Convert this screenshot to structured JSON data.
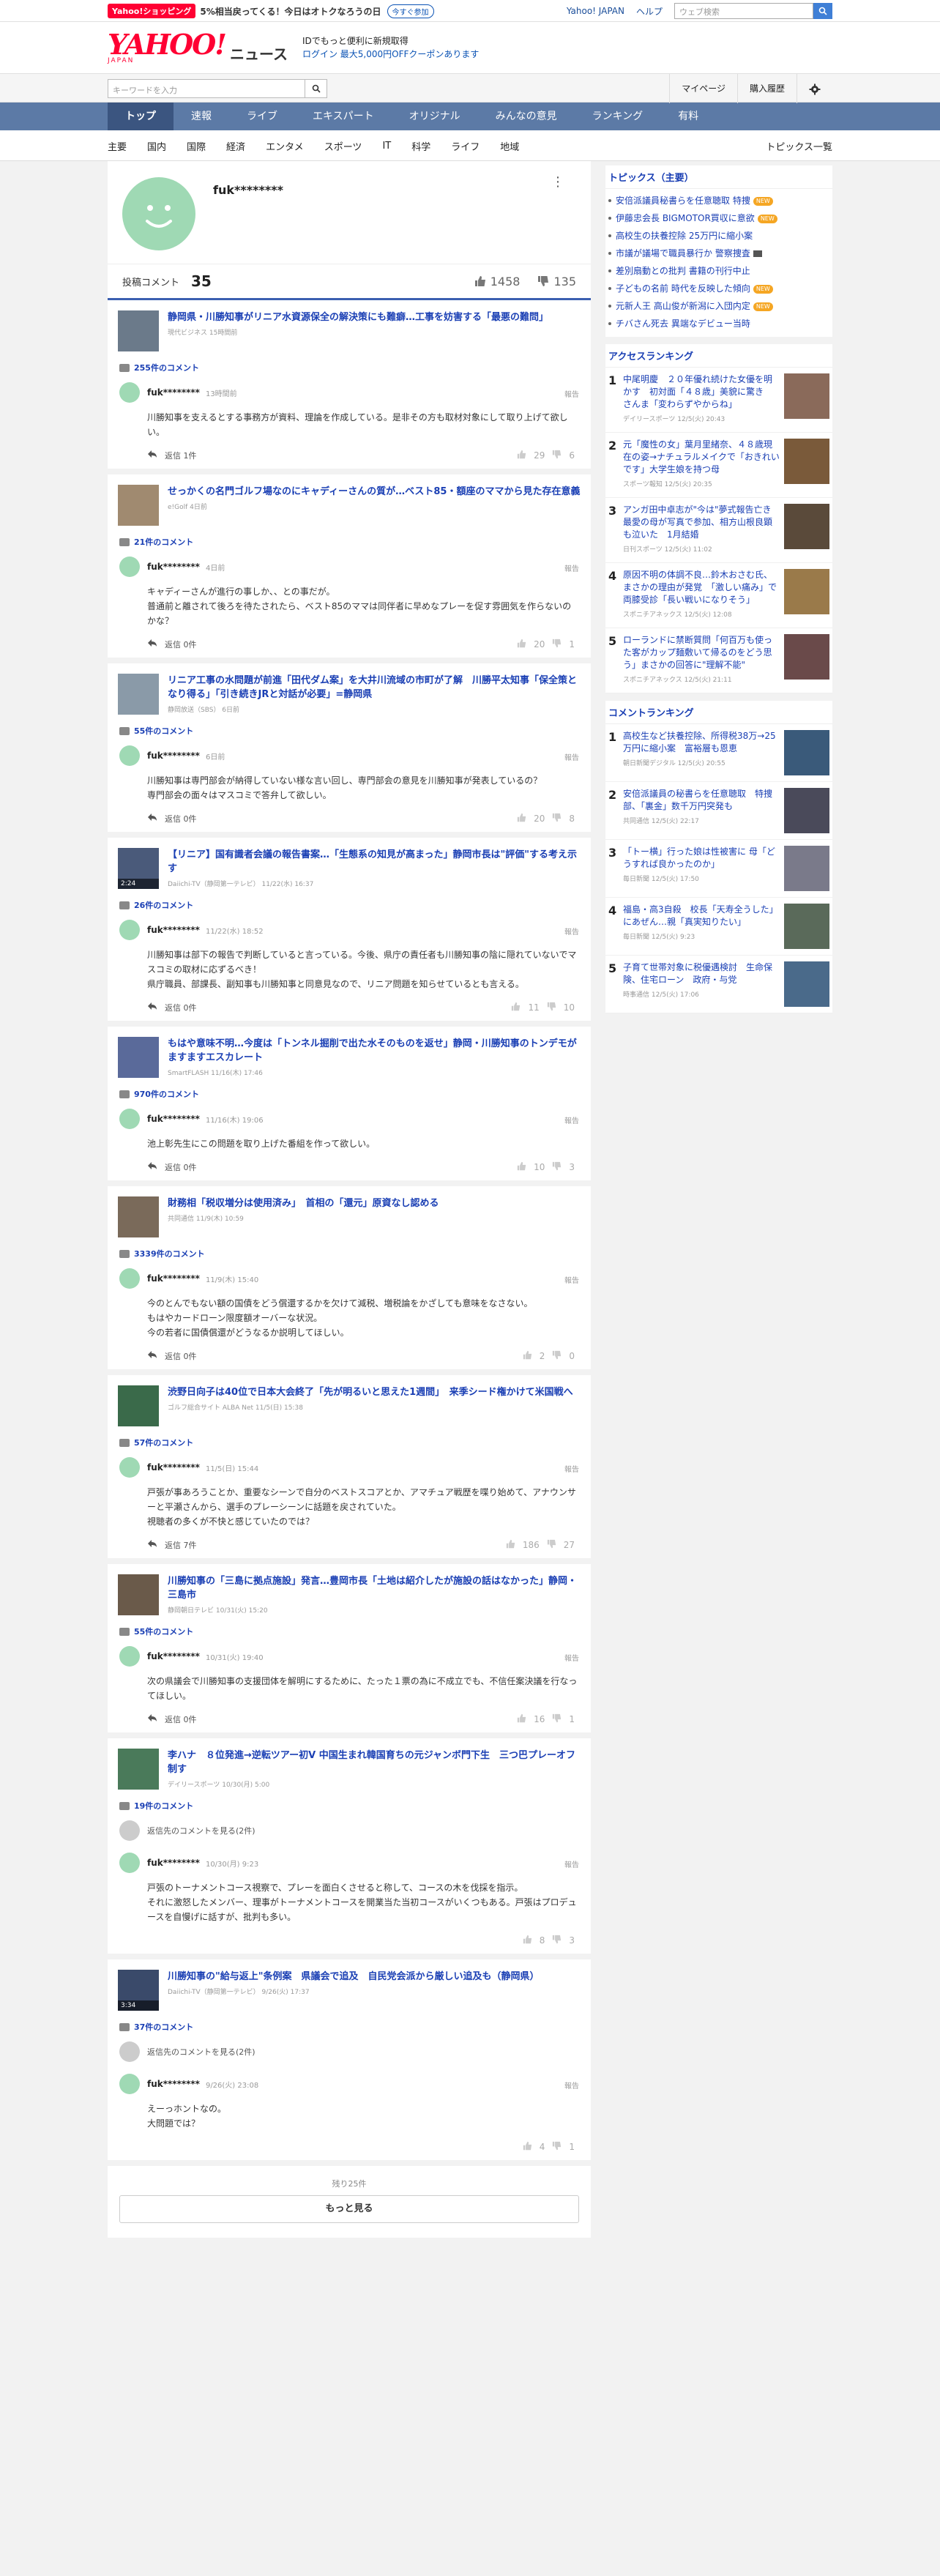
{
  "topstrip": {
    "shopping": "Yahoo!ショッピング",
    "msg": "5%相当戻ってくる！今日はオトクなろうの日",
    "btn": "今すぐ参加",
    "links": [
      "Yahoo! JAPAN",
      "ヘルプ"
    ],
    "search_placeholder": "ウェブ検索"
  },
  "header": {
    "logo": "YAHOO!",
    "logo_sub": "JAPAN",
    "service": "ニュース",
    "promo_line1": "IDでもっと便利に新規取得",
    "promo_line2": "ログイン 最大5,000円OFFクーポンあります"
  },
  "searchbar": {
    "placeholder": "キーワードを入力",
    "links": [
      "マイページ",
      "購入履歴"
    ]
  },
  "gnav": [
    "トップ",
    "速報",
    "ライブ",
    "エキスパート",
    "オリジナル",
    "みんなの意見",
    "ランキング",
    "有料"
  ],
  "subnav": {
    "items": [
      "主要",
      "国内",
      "国際",
      "経済",
      "エンタメ",
      "スポーツ",
      "IT",
      "科学",
      "ライフ",
      "地域"
    ],
    "right": "トピックス一覧"
  },
  "profile": {
    "name": "fuk********",
    "posts_label": "投稿コメント",
    "posts_count": "35",
    "likes": "1458",
    "dislikes": "135"
  },
  "entries": [
    {
      "title": "静岡県・川勝知事がリニア水資源保全の解決策にも難癖…工事を妨害する「最悪の難問」",
      "source": "現代ビジネス 15時間前",
      "count": "255件のコメント",
      "thumb": "#6b7a8a",
      "video": "",
      "comments": [
        {
          "name": "fuk********",
          "date": "13時間前",
          "lines": [
            "川勝知事を支えるとする事務方が資料、理論を作成している。是非その方も取材対象にして取り上げて欲しい。"
          ],
          "reply": "返信 1件",
          "up": "29",
          "down": "6"
        }
      ]
    },
    {
      "title": "せっかくの名門ゴルフ場なのにキャディーさんの質が…ベスト85・額座のママから見た存在意義",
      "source": "e!Golf 4日前",
      "count": "21件のコメント",
      "thumb": "#a08a70",
      "video": "",
      "comments": [
        {
          "name": "fuk********",
          "date": "4日前",
          "lines": [
            "キャディーさんが進行の事しか、、との事だが。",
            "普通前と離されて後ろを待たされたら、ベスト85のママは同伴者に早めなプレーを促す雰囲気を作らないのかな？"
          ],
          "reply": "返信 0件",
          "up": "20",
          "down": "1"
        }
      ]
    },
    {
      "title": "リニア工事の水問題が前進「田代ダム案」を大井川流域の市町が了解　川勝平太知事「保全策となり得る」「引き続きJRと対話が必要」=静岡県",
      "source": "静岡放送（SBS） 6日前",
      "count": "55件のコメント",
      "thumb": "#8a9aa8",
      "video": "",
      "comments": [
        {
          "name": "fuk********",
          "date": "6日前",
          "lines": [
            "川勝知事は専門部会が納得していない様な言い回し、専門部会の意見を川勝知事が発表しているの？",
            "専門部会の面々はマスコミで答弁して欲しい。"
          ],
          "reply": "返信 0件",
          "up": "20",
          "down": "8"
        }
      ]
    },
    {
      "title": "【リニア】国有識者会議の報告書案…「生態系の知見が高まった」静岡市長は\"評価\"する考え示す",
      "source": "Daiichi-TV（静岡第一テレビ） 11/22(水) 16:37",
      "count": "26件のコメント",
      "thumb": "#4a5a7a",
      "video": "2:24",
      "comments": [
        {
          "name": "fuk********",
          "date": "11/22(水) 18:52",
          "lines": [
            "川勝知事は部下の報告で判断していると言っている。今後、県庁の責任者も川勝知事の陰に隠れていないでマスコミの取材に応ずるべき！",
            "県庁職員、部課長、副知事も川勝知事と同意見なので、リニア問題を知らせているとも言える。"
          ],
          "reply": "返信 0件",
          "up": "11",
          "down": "10"
        }
      ]
    },
    {
      "title": "もはや意味不明…今度は「トンネル掘削で出た水そのものを返せ」静岡・川勝知事のトンデモがますますエスカレート",
      "source": "SmartFLASH 11/16(木) 17:46",
      "count": "970件のコメント",
      "thumb": "#5a6a9a",
      "video": "",
      "comments": [
        {
          "name": "fuk********",
          "date": "11/16(木) 19:06",
          "lines": [
            "池上彰先生にこの問題を取り上げた番組を作って欲しい。"
          ],
          "reply": "返信 0件",
          "up": "10",
          "down": "3"
        }
      ]
    },
    {
      "title": "財務相「税収増分は使用済み」　首相の「還元」原資なし認める",
      "source": "共同通信 11/9(木) 10:59",
      "count": "3339件のコメント",
      "thumb": "#7a6a5a",
      "video": "",
      "comments": [
        {
          "name": "fuk********",
          "date": "11/9(木) 15:40",
          "lines": [
            "今のとんでもない額の国債をどう償還するかを欠けて減税、増税論をかざしても意味をなさない。",
            "もはやカードローン限度額オーバーな状況。",
            "今の若者に国債償還がどうなるか説明してほしい。"
          ],
          "reply": "返信 0件",
          "up": "2",
          "down": "0"
        }
      ]
    },
    {
      "title": "渋野日向子は40位で日本大会終了「先が明るいと思えた1週間」　来季シード権かけて米国戦へ",
      "source": "ゴルフ総合サイト ALBA Net 11/5(日) 15:38",
      "count": "57件のコメント",
      "thumb": "#3a6a4a",
      "video": "",
      "comments": [
        {
          "name": "fuk********",
          "date": "11/5(日) 15:44",
          "lines": [
            "戸張が事あろうことか、重要なシーンで自分のベストスコアとか、アマチュア戦歴を喋り始めて、アナウンサーと平瀬さんから、選手のプレーシーンに話題を戻されていた。",
            "視聴者の多くが不快と感じていたのでは？"
          ],
          "reply": "返信 7件",
          "up": "186",
          "down": "27"
        }
      ]
    },
    {
      "title": "川勝知事の「三島に拠点施設」発言…豊岡市長「土地は紹介したが施設の話はなかった」静岡・三島市",
      "source": "静岡朝日テレビ 10/31(火) 15:20",
      "count": "55件のコメント",
      "thumb": "#6a5a4a",
      "video": "",
      "comments": [
        {
          "name": "fuk********",
          "date": "10/31(火) 19:40",
          "lines": [
            "次の県議会で川勝知事の支援団体を解明にするために、たった１票の為に不成立でも、不信任案決議を行なってほしい。"
          ],
          "reply": "返信 0件",
          "up": "16",
          "down": "1"
        }
      ]
    },
    {
      "title": "李ハナ　８位発進→逆転ツアー初V 中国生まれ韓国育ちの元ジャンボ門下生　三つ巴プレーオフ制す",
      "source": "デイリースポーツ 10/30(月) 5:00",
      "count": "19件のコメント",
      "thumb": "#4a7a5a",
      "video": "",
      "parent": "返信先のコメントを見る(2件)",
      "comments": [
        {
          "name": "fuk********",
          "date": "10/30(月) 9:23",
          "lines": [
            "戸張のトーナメントコース視察で、プレーを面白くさせると称して、コースの木を伐採を指示。",
            "それに激怒したメンバー、理事がトーナメントコースを開業当た当初コースがいくつもある。戸張はプロデュースを自慢げに話すが、批判も多い。"
          ],
          "reply": "",
          "up": "8",
          "down": "3"
        }
      ]
    },
    {
      "title": "川勝知事の\"給与返上\"条例案　県議会で追及　自民党会派から厳しい追及も（静岡県）",
      "source": "Daiichi-TV（静岡第一テレビ） 9/26(火) 17:37",
      "count": "37件のコメント",
      "thumb": "#3a4a6a",
      "video": "3:34",
      "parent": "返信先のコメントを見る(2件)",
      "comments": [
        {
          "name": "fuk********",
          "date": "9/26(火) 23:08",
          "lines": [
            "えーっホントなの。",
            "大問題では？"
          ],
          "reply": "",
          "up": "4",
          "down": "1"
        }
      ]
    }
  ],
  "more": {
    "remain": "残り25件",
    "button": "もっと見る"
  },
  "side": {
    "topics_head": "トピックス（主要）",
    "topics": [
      {
        "text": "安倍派議員秘書らを任意聴取 特捜",
        "badge": "NEW"
      },
      {
        "text": "伊藤忠会長 BIGMOTOR買収に意欲",
        "badge": "NEW"
      },
      {
        "text": "高校生の扶養控除 25万円に縮小案",
        "badge": ""
      },
      {
        "text": "市議が議場で職員暴行か 警察捜査",
        "badge": "video"
      },
      {
        "text": "差別扇動との批判 書籍の刊行中止",
        "badge": ""
      },
      {
        "text": "子どもの名前 時代を反映した傾向",
        "badge": "NEW"
      },
      {
        "text": "元新人王 高山俊が新潟に入団内定",
        "badge": "NEW"
      },
      {
        "text": "チバさん死去 異端なデビュー当時",
        "badge": ""
      }
    ],
    "access_head": "アクセスランキング",
    "access": [
      {
        "n": "1",
        "text": "中尾明慶　２０年優れ続けた女優を明かす　初対面「４８歳」美貌に驚き　さんま「変わらずやからね」",
        "src": "デイリースポーツ 12/5(火) 20:43",
        "img": "#8a6a5a"
      },
      {
        "n": "2",
        "text": "元「魔性の女」葉月里緒奈、４８歳現在の姿→ナチュラルメイクで「おきれいです」大学生娘を持つ母",
        "src": "スポーツ報知 12/5(火) 20:35",
        "img": "#7a5a3a"
      },
      {
        "n": "3",
        "text": "アンガ田中卓志が\"今は\"夢式報告亡き最愛の母が写真で参加、相方山根良顕も泣いた　1月結婚",
        "src": "日刊スポーツ 12/5(火) 11:02",
        "img": "#5a4a3a"
      },
      {
        "n": "4",
        "text": "原因不明の体調不良…鈴木おさむ氏、まさかの理由が発覚　「激しい痛み」で両膝受診「長い戦いになりそう」",
        "src": "スポニチアネックス 12/5(火) 12:08",
        "img": "#9a7a4a"
      },
      {
        "n": "5",
        "text": "ローランドに禁断質問「何百万も使った客がカップ麺敷いて帰るのをどう思う」まさかの回答に\"理解不能\"",
        "src": "スポニチアネックス 12/5(火) 21:11",
        "img": "#6a4a4a"
      }
    ],
    "comment_head": "コメントランキング",
    "comments": [
      {
        "n": "1",
        "text": "高校生など扶養控除、所得税38万→25万円に縮小案　富裕層も恩恵",
        "src": "朝日新聞デジタル 12/5(火) 20:55",
        "img": "#3a5a7a"
      },
      {
        "n": "2",
        "text": "安倍派議員の秘書らを任意聴取　特捜部、「裏金」数千万円突発も",
        "src": "共同通信 12/5(火) 22:17",
        "img": "#4a4a5a"
      },
      {
        "n": "3",
        "text": "「トー横」行った娘は性被害に 母「どうすれば良かったのか」",
        "src": "毎日新聞 12/5(火) 17:50",
        "img": "#7a7a8a"
      },
      {
        "n": "4",
        "text": "福島・高3自殺　校長「天寿全うした」にあぜん…親「真実知りたい」",
        "src": "毎日新聞 12/5(火) 9:23",
        "img": "#5a6a5a"
      },
      {
        "n": "5",
        "text": "子育て世帯対象に税優遇検討　生命保険、住宅ローン　政府・与党",
        "src": "時事通信 12/5(火) 17:06",
        "img": "#4a6a8a"
      }
    ]
  }
}
